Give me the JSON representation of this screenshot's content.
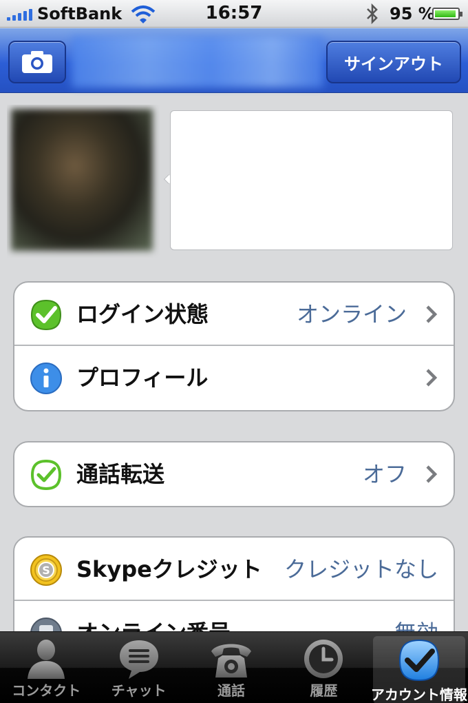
{
  "status_bar": {
    "carrier": "SoftBank",
    "time": "16:57",
    "battery_percent": "95 %",
    "battery_level": 0.95
  },
  "nav": {
    "signout_label": "サインアウト",
    "camera_icon": "camera-icon"
  },
  "groups": [
    {
      "rows": [
        {
          "icon": "online-status-icon",
          "label": "ログイン状態",
          "value": "オンライン",
          "chevron": true
        },
        {
          "icon": "info-icon",
          "label": "プロフィール",
          "value": "",
          "chevron": true
        }
      ]
    },
    {
      "rows": [
        {
          "icon": "call-forward-icon",
          "label": "通話転送",
          "value": "オフ",
          "chevron": true
        }
      ]
    },
    {
      "rows": [
        {
          "icon": "skype-credit-icon",
          "label": "Skypeクレジット",
          "value": "クレジットなし",
          "chevron": false
        },
        {
          "icon": "online-number-icon",
          "label": "オンライン番号",
          "value": "無効",
          "chevron": false
        }
      ]
    }
  ],
  "tabs": [
    {
      "label": "コンタクト",
      "icon": "contacts-icon",
      "active": false
    },
    {
      "label": "チャット",
      "icon": "chat-icon",
      "active": false
    },
    {
      "label": "通話",
      "icon": "phone-icon",
      "active": false
    },
    {
      "label": "履歴",
      "icon": "history-clock-icon",
      "active": false
    },
    {
      "label": "アカウント情報",
      "icon": "account-check-icon",
      "active": true
    }
  ],
  "colors": {
    "nav_blue": "#2c5ed6",
    "value_text": "#4b6b98",
    "online_green": "#5cc12b"
  }
}
